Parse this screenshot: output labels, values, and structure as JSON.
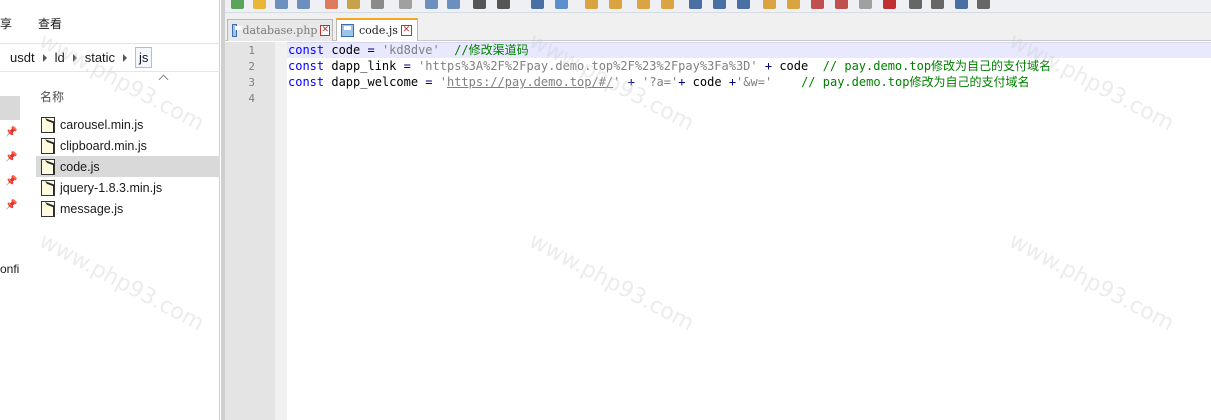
{
  "explorer": {
    "ribbon_tabs": [
      "享",
      "查看"
    ],
    "breadcrumb": [
      "usdt",
      "ld",
      "static",
      "js"
    ],
    "nav_partial_text": "onfi",
    "column_header": "名称",
    "files": [
      {
        "name": "carousel.min.js",
        "selected": false
      },
      {
        "name": "clipboard.min.js",
        "selected": false
      },
      {
        "name": "code.js",
        "selected": true
      },
      {
        "name": "jquery-1.8.3.min.js",
        "selected": false
      },
      {
        "name": "message.js",
        "selected": false
      }
    ]
  },
  "editor": {
    "tabs": [
      {
        "label": "database.php",
        "active": false
      },
      {
        "label": "code.js",
        "active": true
      }
    ],
    "line_numbers": [
      "1",
      "2",
      "3",
      "4"
    ],
    "lines": [
      [
        {
          "t": "const",
          "c": "kw"
        },
        {
          "t": " code ",
          "c": ""
        },
        {
          "t": "=",
          "c": "op"
        },
        {
          "t": " ",
          "c": ""
        },
        {
          "t": "'kd8dve'",
          "c": "str"
        },
        {
          "t": "  ",
          "c": ""
        },
        {
          "t": "//修改渠道码",
          "c": "cm"
        }
      ],
      [
        {
          "t": "const",
          "c": "kw"
        },
        {
          "t": " dapp_link ",
          "c": ""
        },
        {
          "t": "=",
          "c": "op"
        },
        {
          "t": " ",
          "c": ""
        },
        {
          "t": "'https%3A%2F%2Fpay.demo.top%2F%23%2Fpay%3Fa%3D'",
          "c": "str"
        },
        {
          "t": " ",
          "c": ""
        },
        {
          "t": "+",
          "c": "op"
        },
        {
          "t": " code  ",
          "c": ""
        },
        {
          "t": "// pay.demo.top修改为自己的支付域名",
          "c": "cm"
        }
      ],
      [
        {
          "t": "const",
          "c": "kw"
        },
        {
          "t": " dapp_welcome ",
          "c": ""
        },
        {
          "t": "=",
          "c": "op"
        },
        {
          "t": " ",
          "c": ""
        },
        {
          "t": "'",
          "c": "str"
        },
        {
          "t": "https://pay.demo.top/#/",
          "c": "str url"
        },
        {
          "t": "'",
          "c": "str"
        },
        {
          "t": " ",
          "c": ""
        },
        {
          "t": "+",
          "c": "op"
        },
        {
          "t": " ",
          "c": ""
        },
        {
          "t": "'?a='",
          "c": "str"
        },
        {
          "t": "+",
          "c": "op"
        },
        {
          "t": " code ",
          "c": ""
        },
        {
          "t": "+",
          "c": "op"
        },
        {
          "t": "'&w='",
          "c": "str"
        },
        {
          "t": "    ",
          "c": ""
        },
        {
          "t": "// pay.demo.top修改为自己的支付域名",
          "c": "cm"
        }
      ],
      []
    ]
  },
  "watermark": "www.php93.com"
}
